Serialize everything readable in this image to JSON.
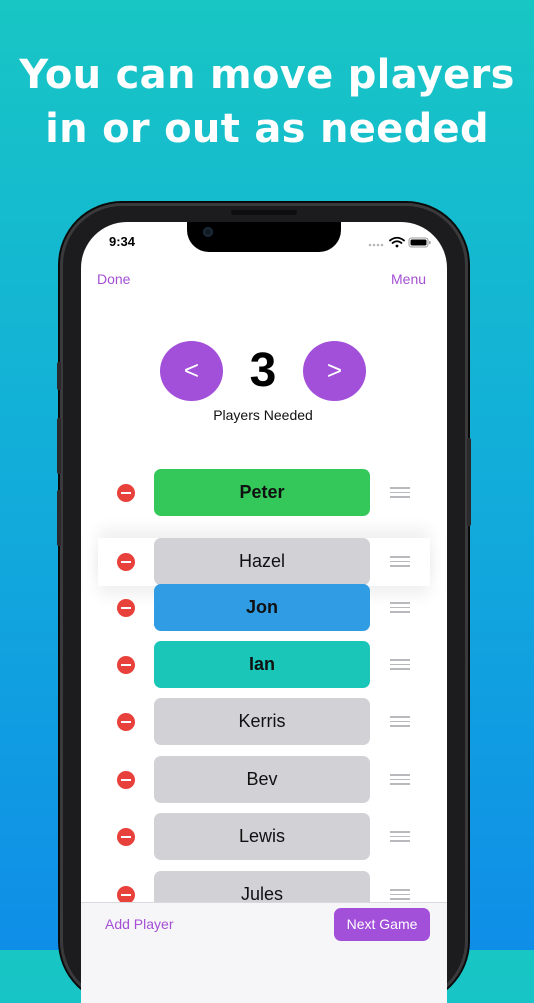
{
  "headline": {
    "line1": "You can move players",
    "line2": "in or out as needed"
  },
  "status_bar": {
    "time": "9:34",
    "icons": [
      "cellular-dots-icon",
      "wifi-icon",
      "battery-icon"
    ]
  },
  "nav": {
    "left_label": "Done",
    "right_label": "Menu"
  },
  "stepper": {
    "decrement_label": "<",
    "increment_label": ">",
    "value": "3",
    "caption": "Players Needed"
  },
  "players": [
    {
      "name": "Peter",
      "color": "#34c759",
      "bold": true
    },
    {
      "name": "Hazel",
      "color": "#d1d1d6",
      "bold": false,
      "dragging": true
    },
    {
      "name": "Jon",
      "color": "#2f9ce3",
      "bold": true
    },
    {
      "name": "Ian",
      "color": "#19c6b8",
      "bold": true
    },
    {
      "name": "Kerris",
      "color": "#d1d1d6",
      "bold": false
    },
    {
      "name": "Bev",
      "color": "#d1d1d6",
      "bold": false
    },
    {
      "name": "Lewis",
      "color": "#d1d1d6",
      "bold": false
    },
    {
      "name": "Jules",
      "color": "#d1d1d6",
      "bold": false
    }
  ],
  "bottom_bar": {
    "add_label": "Add Player",
    "next_label": "Next Game"
  },
  "colors": {
    "accent": "#a24fd9",
    "delete": "#e8403a"
  }
}
